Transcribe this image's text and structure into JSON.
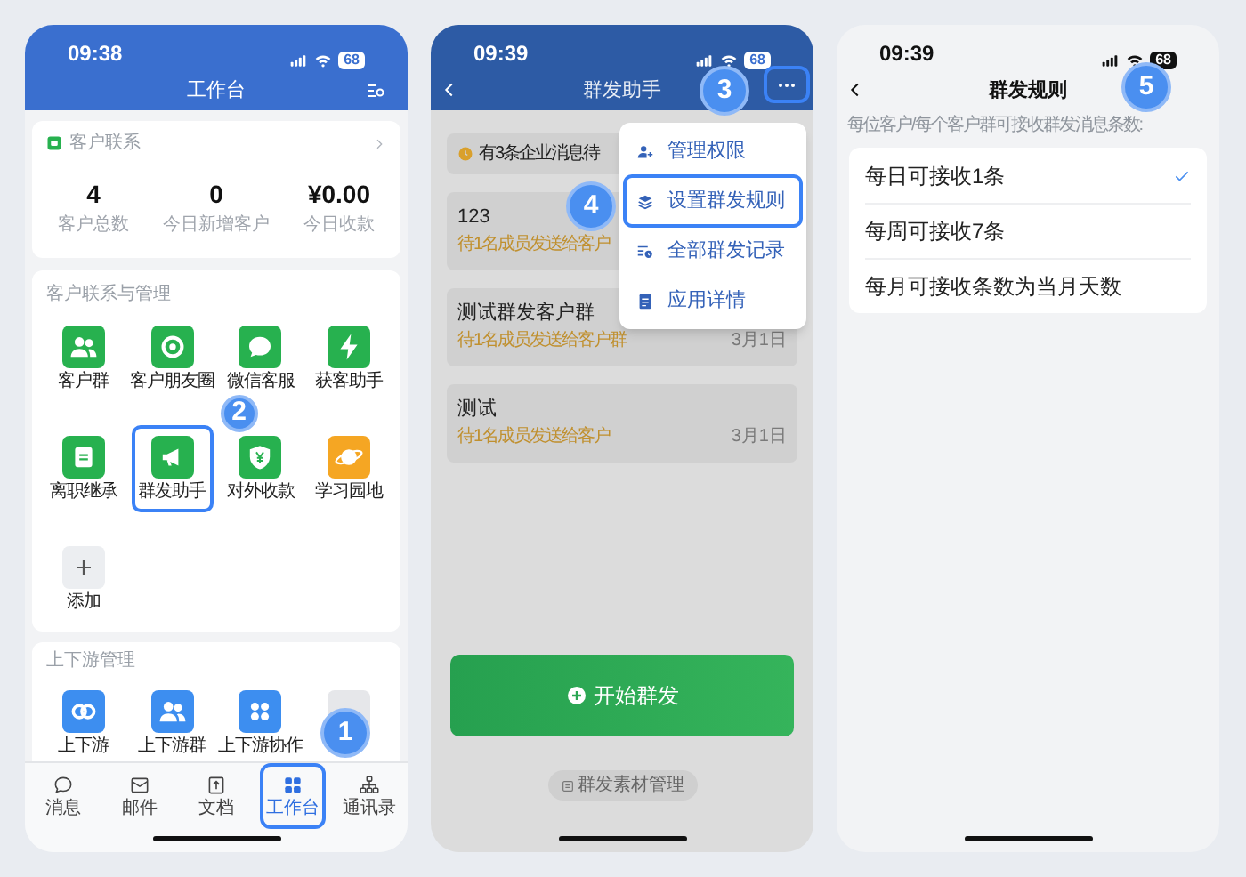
{
  "workbench": {
    "time": "09:38",
    "battery": "68",
    "title": "工作台",
    "contact_card": {
      "title": "客户联系",
      "stats": [
        {
          "value": "4",
          "label": "客户总数"
        },
        {
          "value": "0",
          "label": "今日新增客户"
        },
        {
          "value": "¥0.00",
          "label": "今日收款"
        }
      ]
    },
    "sections": [
      {
        "title": "客户联系与管理",
        "items": [
          {
            "label": "客户群",
            "kind": "group",
            "color": "#27b14f",
            "highlighted": false
          },
          {
            "label": "客户朋友圈",
            "kind": "aperture",
            "color": "#27b14f",
            "highlighted": false
          },
          {
            "label": "微信客服",
            "kind": "chat",
            "color": "#27b14f",
            "highlighted": false
          },
          {
            "label": "获客助手",
            "kind": "bolt",
            "color": "#27b14f",
            "highlighted": false
          },
          {
            "label": "离职继承",
            "kind": "doc",
            "color": "#27b14f",
            "highlighted": false
          },
          {
            "label": "群发助手",
            "kind": "megaphone",
            "color": "#27b14f",
            "highlighted": true,
            "step": "2"
          },
          {
            "label": "对外收款",
            "kind": "yen",
            "color": "#27b14f",
            "highlighted": false
          },
          {
            "label": "学习园地",
            "kind": "planet",
            "color": "#f5a623",
            "highlighted": false
          },
          {
            "label": "添加",
            "kind": "plus",
            "color": "#eceef1",
            "highlighted": false
          }
        ]
      },
      {
        "title": "上下游管理",
        "items": [
          {
            "label": "上下游",
            "kind": "link",
            "color": "#3d8ef0",
            "highlighted": false
          },
          {
            "label": "上下游群",
            "kind": "group",
            "color": "#3d8ef0",
            "highlighted": false
          },
          {
            "label": "上下游协作",
            "kind": "dots",
            "color": "#3d8ef0",
            "highlighted": false
          },
          {
            "kind": "blank",
            "color": "#e6e7ea",
            "highlighted": false
          }
        ]
      }
    ],
    "tabs": [
      {
        "label": "消息",
        "kind": "chat",
        "selected": false,
        "highlighted": false
      },
      {
        "label": "邮件",
        "kind": "mail",
        "selected": false,
        "highlighted": false
      },
      {
        "label": "文档",
        "kind": "doc",
        "selected": false,
        "highlighted": false
      },
      {
        "label": "工作台",
        "kind": "grid",
        "selected": true,
        "highlighted": true,
        "step": "1"
      },
      {
        "label": "通讯录",
        "kind": "org",
        "selected": false,
        "highlighted": false
      }
    ]
  },
  "broadcast": {
    "time": "09:39",
    "battery": "68",
    "title": "群发助手",
    "more_button": {
      "highlighted": true,
      "step": "3"
    },
    "notice": "有3条企业消息待",
    "messages": [
      {
        "title": "123",
        "status": "待1名成员发送给客户"
      },
      {
        "title": "测试群发客户群",
        "status": "待1名成员发送给客户群",
        "date": "3月1日"
      },
      {
        "title": "测试",
        "status": "待1名成员发送给客户",
        "date": "3月1日"
      }
    ],
    "start_button": "开始群发",
    "material_button": "群发素材管理",
    "menu": [
      {
        "label": "管理权限",
        "kind": "person",
        "highlighted": false
      },
      {
        "label": "设置群发规则",
        "kind": "layers",
        "highlighted": true,
        "step": "4"
      },
      {
        "label": "全部群发记录",
        "kind": "records",
        "highlighted": false
      },
      {
        "label": "应用详情",
        "kind": "appdoc",
        "highlighted": false
      }
    ]
  },
  "rules": {
    "time": "09:39",
    "battery": "68",
    "title": "群发规则",
    "step": "5",
    "hint": "每位客户/每个客户群可接收群发消息条数:",
    "options": [
      {
        "label": "每日可接收1条",
        "selected": true
      },
      {
        "label": "每周可接收7条",
        "selected": false
      },
      {
        "label": "每月可接收条数为当月天数",
        "selected": false
      }
    ]
  }
}
